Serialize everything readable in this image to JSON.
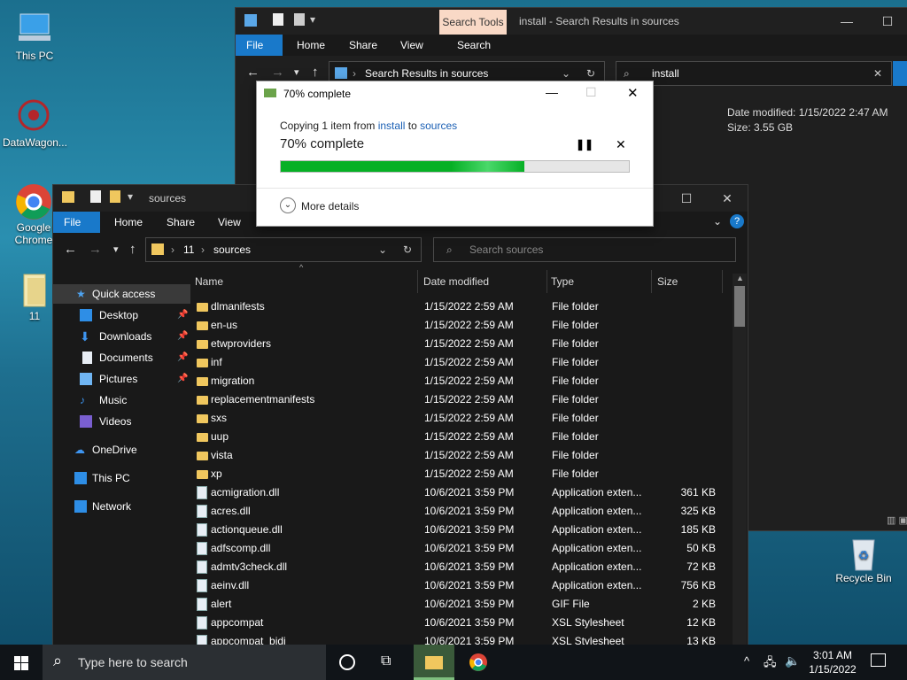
{
  "desktop": {
    "icons": [
      {
        "label": "This PC"
      },
      {
        "label": "DataWagon..."
      },
      {
        "label": "Google Chrome"
      },
      {
        "label": "11"
      },
      {
        "label": "Recycle Bin"
      }
    ]
  },
  "search_window": {
    "context_tab": "Search Tools",
    "title": "install - Search Results in sources",
    "ribbon_tabs": [
      "File",
      "Home",
      "Share",
      "View",
      "Search"
    ],
    "address": "Search Results in sources",
    "search_value": "install",
    "detail_modified": "Date modified: 1/15/2022 2:47 AM",
    "detail_size": "Size: 3.55 GB"
  },
  "copy_dialog": {
    "title": "70% complete",
    "copying_prefix": "Copying 1 item from ",
    "from": "install",
    "to_word": " to ",
    "to": "sources",
    "status": "70% complete",
    "progress": 0.7,
    "more_details": "More details"
  },
  "explorer": {
    "title": "sources",
    "ribbon_tabs": [
      "File",
      "Home",
      "Share",
      "View"
    ],
    "breadcrumb": [
      "11",
      "sources"
    ],
    "search_placeholder": "Search sources",
    "columns": [
      "Name",
      "Date modified",
      "Type",
      "Size"
    ],
    "sidebar": [
      {
        "label": "Quick access",
        "icon": "star-icon"
      },
      {
        "label": "Desktop",
        "icon": "desktop-icon"
      },
      {
        "label": "Downloads",
        "icon": "download-icon"
      },
      {
        "label": "Documents",
        "icon": "documents-icon"
      },
      {
        "label": "Pictures",
        "icon": "pictures-icon"
      },
      {
        "label": "Music",
        "icon": "music-icon"
      },
      {
        "label": "Videos",
        "icon": "videos-icon"
      },
      {
        "label": "OneDrive",
        "icon": "cloud-icon"
      },
      {
        "label": "This PC",
        "icon": "computer-icon"
      },
      {
        "label": "Network",
        "icon": "network-icon"
      }
    ],
    "rows": [
      {
        "name": "dlmanifests",
        "date": "1/15/2022 2:59 AM",
        "type": "File folder",
        "size": "",
        "kind": "folder"
      },
      {
        "name": "en-us",
        "date": "1/15/2022 2:59 AM",
        "type": "File folder",
        "size": "",
        "kind": "folder"
      },
      {
        "name": "etwproviders",
        "date": "1/15/2022 2:59 AM",
        "type": "File folder",
        "size": "",
        "kind": "folder"
      },
      {
        "name": "inf",
        "date": "1/15/2022 2:59 AM",
        "type": "File folder",
        "size": "",
        "kind": "folder"
      },
      {
        "name": "migration",
        "date": "1/15/2022 2:59 AM",
        "type": "File folder",
        "size": "",
        "kind": "folder"
      },
      {
        "name": "replacementmanifests",
        "date": "1/15/2022 2:59 AM",
        "type": "File folder",
        "size": "",
        "kind": "folder"
      },
      {
        "name": "sxs",
        "date": "1/15/2022 2:59 AM",
        "type": "File folder",
        "size": "",
        "kind": "folder"
      },
      {
        "name": "uup",
        "date": "1/15/2022 2:59 AM",
        "type": "File folder",
        "size": "",
        "kind": "folder"
      },
      {
        "name": "vista",
        "date": "1/15/2022 2:59 AM",
        "type": "File folder",
        "size": "",
        "kind": "folder"
      },
      {
        "name": "xp",
        "date": "1/15/2022 2:59 AM",
        "type": "File folder",
        "size": "",
        "kind": "folder"
      },
      {
        "name": "acmigration.dll",
        "date": "10/6/2021 3:59 PM",
        "type": "Application exten...",
        "size": "361 KB",
        "kind": "file"
      },
      {
        "name": "acres.dll",
        "date": "10/6/2021 3:59 PM",
        "type": "Application exten...",
        "size": "325 KB",
        "kind": "file"
      },
      {
        "name": "actionqueue.dll",
        "date": "10/6/2021 3:59 PM",
        "type": "Application exten...",
        "size": "185 KB",
        "kind": "file"
      },
      {
        "name": "adfscomp.dll",
        "date": "10/6/2021 3:59 PM",
        "type": "Application exten...",
        "size": "50 KB",
        "kind": "file"
      },
      {
        "name": "admtv3check.dll",
        "date": "10/6/2021 3:59 PM",
        "type": "Application exten...",
        "size": "72 KB",
        "kind": "file"
      },
      {
        "name": "aeinv.dll",
        "date": "10/6/2021 3:59 PM",
        "type": "Application exten...",
        "size": "756 KB",
        "kind": "file"
      },
      {
        "name": "alert",
        "date": "10/6/2021 3:59 PM",
        "type": "GIF File",
        "size": "2 KB",
        "kind": "file"
      },
      {
        "name": "appcompat",
        "date": "10/6/2021 3:59 PM",
        "type": "XSL Stylesheet",
        "size": "12 KB",
        "kind": "file"
      },
      {
        "name": "appcompat_bidi",
        "date": "10/6/2021 3:59 PM",
        "type": "XSL Stylesheet",
        "size": "13 KB",
        "kind": "file"
      }
    ]
  },
  "taskbar": {
    "search_placeholder": "Type here to search",
    "time": "3:01 AM",
    "date": "1/15/2022"
  },
  "colors": {
    "accent": "#1979ca",
    "progress": "#06b025"
  }
}
